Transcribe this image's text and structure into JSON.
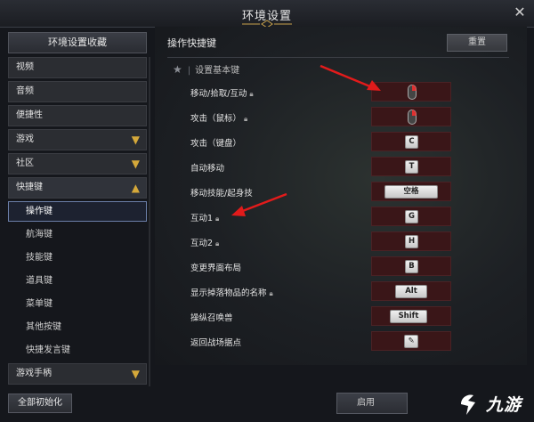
{
  "window": {
    "title": "环境设置"
  },
  "sidebar": {
    "header": "环境设置收藏",
    "items": [
      {
        "label": "视频",
        "expandable": false
      },
      {
        "label": "音频",
        "expandable": false
      },
      {
        "label": "便捷性",
        "expandable": false
      },
      {
        "label": "游戏",
        "expandable": true,
        "expanded": false
      },
      {
        "label": "社区",
        "expandable": true,
        "expanded": false
      },
      {
        "label": "快捷键",
        "expandable": true,
        "expanded": true
      }
    ],
    "subitems": [
      {
        "label": "操作键",
        "active": true
      },
      {
        "label": "航海键",
        "active": false
      },
      {
        "label": "技能键",
        "active": false
      },
      {
        "label": "道具键",
        "active": false
      },
      {
        "label": "菜单键",
        "active": false
      },
      {
        "label": "其他按键",
        "active": false
      },
      {
        "label": "快捷发言键",
        "active": false
      }
    ],
    "after": {
      "label": "游戏手柄",
      "expandable": true,
      "expanded": false
    },
    "reset_all": "全部初始化"
  },
  "main": {
    "section_title": "操作快捷键",
    "reset": "重置",
    "subsection": "设置基本键",
    "rows": [
      {
        "label": "移动/拾取/互动",
        "locked": true,
        "key": "",
        "key_icon": "mouse-right-icon"
      },
      {
        "label": "攻击（鼠标）",
        "locked": true,
        "key": "",
        "key_icon": "mouse-right-icon"
      },
      {
        "label": "攻击（键盘）",
        "locked": false,
        "key": "C"
      },
      {
        "label": "自动移动",
        "locked": false,
        "key": "T"
      },
      {
        "label": "移动技能/起身技",
        "locked": false,
        "key": "空格"
      },
      {
        "label": "互动1",
        "locked": true,
        "key": "G"
      },
      {
        "label": "互动2",
        "locked": true,
        "key": "H"
      },
      {
        "label": "变更界面布局",
        "locked": false,
        "key": "B"
      },
      {
        "label": "显示掉落物品的名称",
        "locked": true,
        "key": "Alt"
      },
      {
        "label": "操纵召唤兽",
        "locked": false,
        "key": "Shift"
      },
      {
        "label": "返回战场据点",
        "locked": false,
        "key": "",
        "key_icon": "pencil-icon"
      }
    ]
  },
  "footer": {
    "apply": "启用"
  },
  "watermark": {
    "text": "九游"
  },
  "colors": {
    "accent_gold": "#d4a83a",
    "annotation_red": "#e21b1b",
    "key_slot": "#3a1618"
  }
}
